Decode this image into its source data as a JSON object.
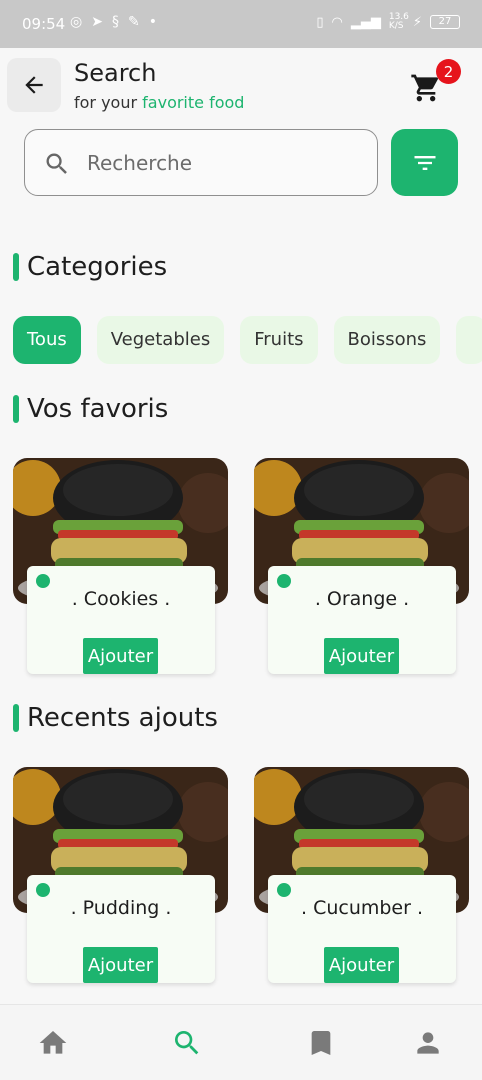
{
  "status_bar": {
    "time": "09:54",
    "network_speed": "13.6 K/S",
    "battery": "27",
    "icons_left": [
      "whatsapp-icon",
      "telegram-icon",
      "notification-icon",
      "app-icon",
      "dot-icon"
    ],
    "icons_right": [
      "vibrate-icon",
      "wifi-icon",
      "signal-icon",
      "charging-icon",
      "battery-icon"
    ]
  },
  "header": {
    "title": "Search",
    "subtitle_prefix": "for your ",
    "subtitle_accent": "favorite food",
    "cart_count": "2"
  },
  "search": {
    "placeholder": "Recherche",
    "value": ""
  },
  "sections": {
    "categories": "Categories",
    "favorites": "Vos favoris",
    "recent": "Recents ajouts"
  },
  "categories": [
    "Tous",
    "Vegetables",
    "Fruits",
    "Boissons",
    ""
  ],
  "favorites": [
    {
      "name": ". Cookies .",
      "button": "Ajouter"
    },
    {
      "name": ". Orange .",
      "button": "Ajouter"
    }
  ],
  "recent": [
    {
      "name": ". Pudding .",
      "button": "Ajouter"
    },
    {
      "name": ". Cucumber .",
      "button": "Ajouter"
    }
  ],
  "nav": [
    "home-icon",
    "search-icon",
    "bookmark-icon",
    "profile-icon"
  ],
  "colors": {
    "accent": "#1db46f",
    "badge": "#e6141c",
    "chip_bg": "#e9f8e6"
  }
}
